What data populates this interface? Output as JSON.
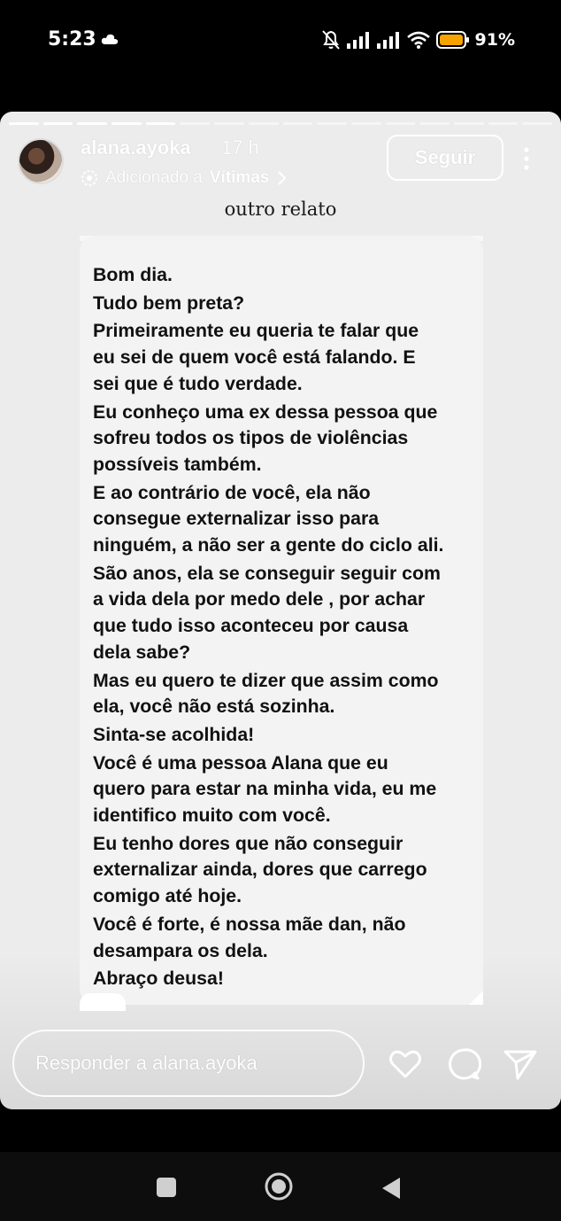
{
  "status_bar": {
    "time": "5:23",
    "battery": "91%"
  },
  "story": {
    "progress_segments_total": 16,
    "progress_segments_done": 5,
    "username": "alana.ayoka",
    "time_ago": "17 h",
    "added_prefix": "Adicionado a",
    "highlight_name": "Vítimas",
    "follow_label": "Seguir",
    "caption": "outro relato",
    "message_paragraphs": [
      "Bom dia.",
      "Tudo bem preta?",
      "Primeiramente eu queria te falar que\neu sei de quem você está falando. E\nsei que é tudo verdade.",
      "Eu conheço uma ex dessa pessoa que\nsofreu todos os tipos de violências\npossíveis também.",
      "E ao contrário de você, ela não\nconsegue externalizar isso para\nninguém, a não ser a gente do ciclo ali.",
      "São anos, ela se conseguir seguir com\na vida dela por medo dele , por achar\nque tudo isso aconteceu por causa\ndela sabe?",
      "Mas eu quero te dizer que assim como\nela, você não está sozinha.",
      "Sinta-se acolhida!",
      "Você é uma pessoa Alana que eu\nquero para estar na minha vida, eu me\nidentifico muito com você.",
      "Eu tenho dores que não conseguir\nexternalizar ainda, dores que carrego\ncomigo até hoje.",
      "Você é forte, é nossa mãe dan, não\ndesampara os dela.",
      "Abraço deusa!"
    ],
    "reply_placeholder": "Responder a alana.ayoka"
  },
  "icons": {
    "cloud": "cloud-icon",
    "mute": "bell-off-icon",
    "signal": "signal-icon",
    "wifi": "wifi-icon",
    "battery": "battery-icon",
    "more": "more-vertical-icon",
    "highlight": "highlight-icon",
    "chevron": "chevron-right-icon",
    "like": "heart-icon",
    "comment": "comment-icon",
    "share": "send-icon",
    "nav_recents": "square-icon",
    "nav_home": "circle-icon",
    "nav_back": "triangle-back-icon"
  },
  "colors": {
    "battery": "#f5a300",
    "story_bg": "#ececec"
  }
}
